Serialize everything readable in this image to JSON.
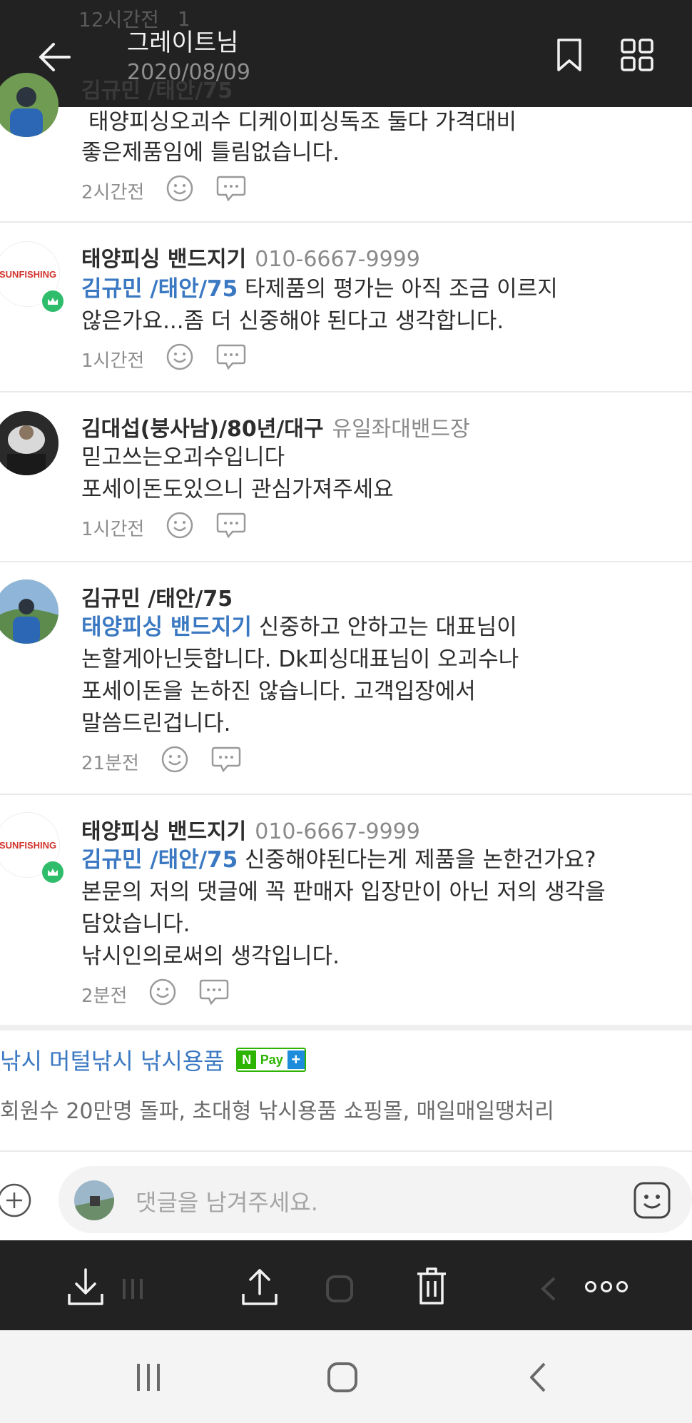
{
  "header": {
    "ghost_time": "12시간전",
    "ghost_count": "1",
    "title": "그레이트님",
    "date": "2020/08/09",
    "back_icon": "arrow-left-icon",
    "bookmark_icon": "bookmark-icon",
    "grid_icon": "grid-icon"
  },
  "comments": [
    {
      "author": "김규민 /태안/75",
      "lines": [
        "태양피싱오괴수 디케이피싱독조 둘다 가격대비",
        "좋은제품임에 틀림없습니다."
      ],
      "time": "2시간전"
    },
    {
      "author": "태양피싱 밴드지기",
      "author_sub": "010-6667-9999",
      "avatar_label": "SUNFISHING",
      "mention": "김규민 /태안/75",
      "line1_rest": " 타제품의 평가는 아직 조금 이르지",
      "line2": "않은가요...좀 더 신중해야 된다고 생각합니다.",
      "time": "1시간전"
    },
    {
      "author": "김대섭(붕사남)/80년/대구",
      "author_sub": "유일좌대밴드장",
      "lines": [
        "믿고쓰는오괴수입니다",
        "포세이돈도있으니 관심가져주세요"
      ],
      "time": "1시간전"
    },
    {
      "author": "김규민 /태안/75",
      "mention": "태양피싱 밴드지기",
      "line1_rest": " 신중하고 안하고는 대표님이",
      "lines": [
        "논할게아닌듯합니다. Dk피싱대표님이 오괴수나",
        "포세이돈을 논하진 않습니다. 고객입장에서",
        "말씀드린겁니다."
      ],
      "time": "21분전"
    },
    {
      "author": "태양피싱 밴드지기",
      "author_sub": "010-6667-9999",
      "avatar_label": "SUNFISHING",
      "mention": "김규민 /태안/75",
      "line1_rest": " 신중해야된다는게 제품을 논한건가요?",
      "lines": [
        "본문의 저의 댓글에 꼭 판매자 입장만이 아닌 저의 생각을",
        "담았습니다.",
        "낚시인의로써의 생각입니다."
      ],
      "time": "2분전"
    }
  ],
  "ad": {
    "title": "낚시 머털낚시 낚시용품",
    "badge_n": "N",
    "badge_pay": "Pay",
    "badge_plus": "+",
    "desc": "회원수 20만명 돌파, 초대형 낚시용품 쇼핑몰, 매일매일땡처리"
  },
  "comment_input": {
    "placeholder": "댓글을 남겨주세요."
  },
  "colors": {
    "dark_bar": "#222222",
    "mention_blue": "#3a78c2",
    "host_badge_green": "#2fbd6b"
  }
}
